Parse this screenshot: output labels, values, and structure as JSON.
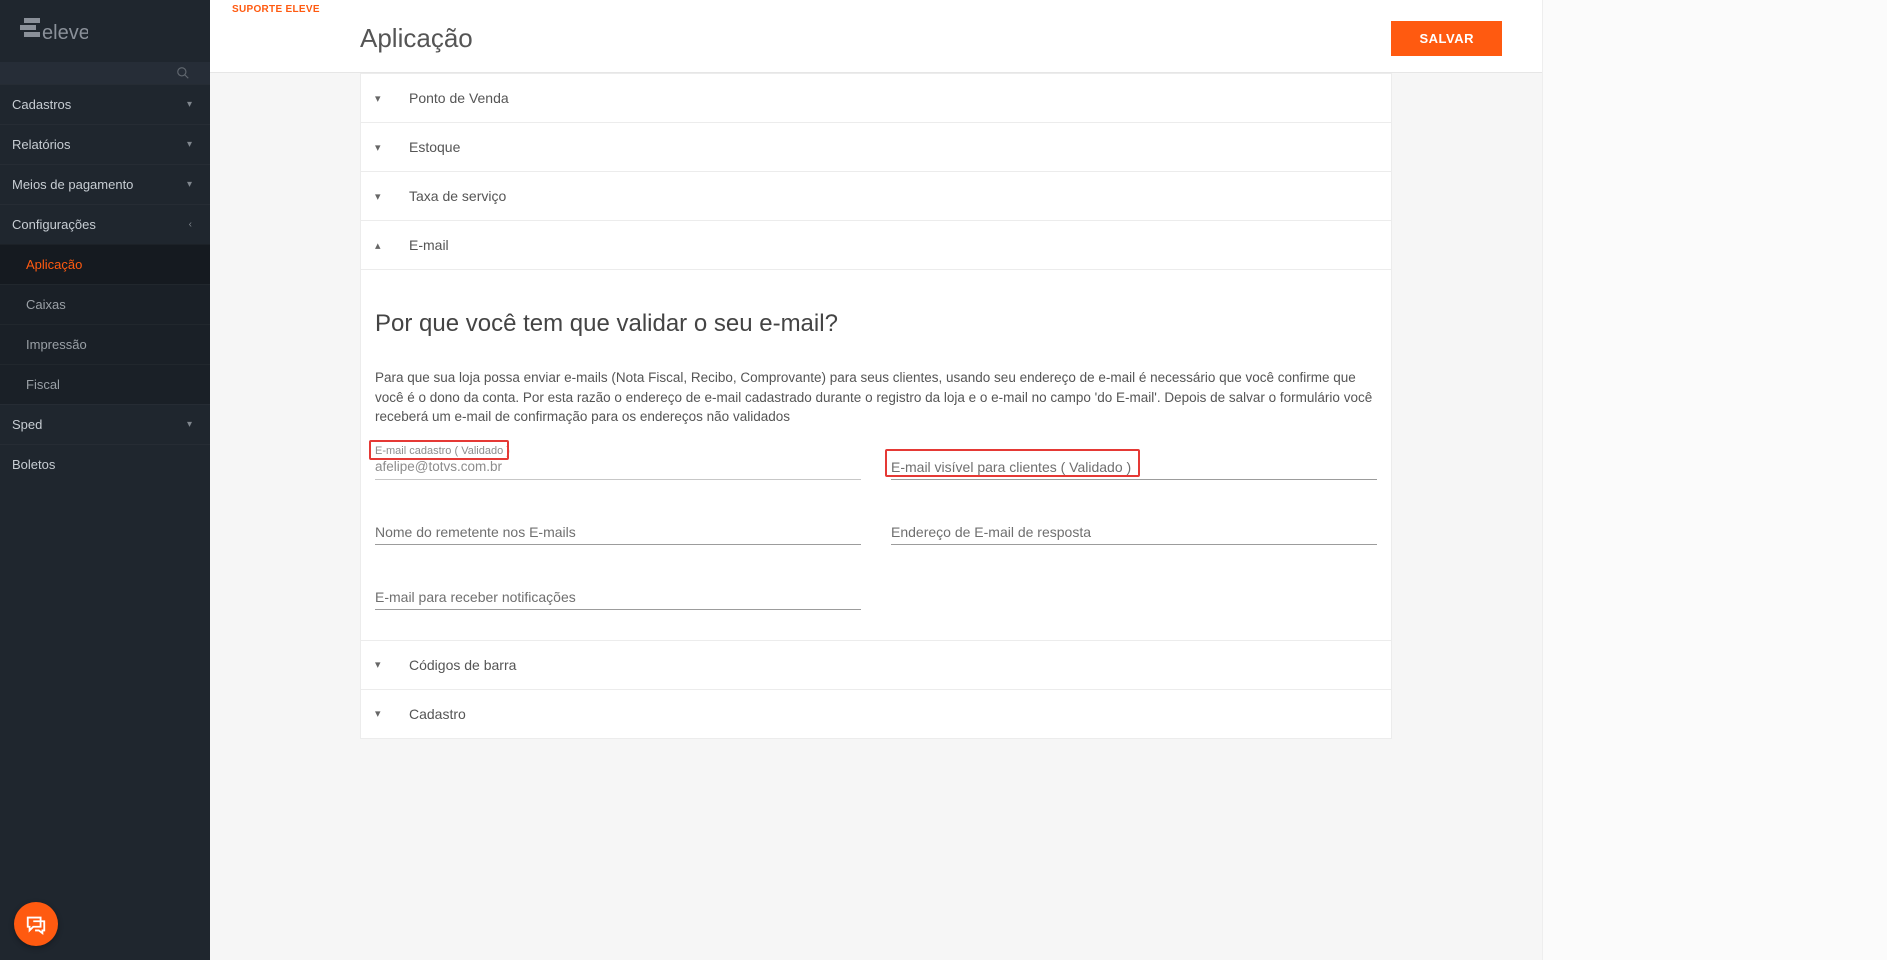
{
  "logo_text": "eleve",
  "breadcrumb": "SUPORTE ELEVE",
  "page_title": "Aplicação",
  "save_label": "SALVAR",
  "sidebar": {
    "items": [
      {
        "label": "Cadastros",
        "expandable": true,
        "expanded": false
      },
      {
        "label": "Relatórios",
        "expandable": true,
        "expanded": false
      },
      {
        "label": "Meios de pagamento",
        "expandable": true,
        "expanded": false
      },
      {
        "label": "Configurações",
        "expandable": true,
        "expanded": true,
        "children": [
          {
            "label": "Aplicação",
            "active": true
          },
          {
            "label": "Caixas",
            "active": false
          },
          {
            "label": "Impressão",
            "active": false
          },
          {
            "label": "Fiscal",
            "active": false
          }
        ]
      },
      {
        "label": "Sped",
        "expandable": true,
        "expanded": false
      },
      {
        "label": "Boletos",
        "expandable": false,
        "expanded": false
      }
    ]
  },
  "accordion": {
    "ponto_de_venda": {
      "label": "Ponto de Venda",
      "open": false
    },
    "estoque": {
      "label": "Estoque",
      "open": false
    },
    "taxa_servico": {
      "label": "Taxa de serviço",
      "open": false
    },
    "email": {
      "label": "E-mail",
      "open": true
    },
    "codigos_barra": {
      "label": "Códigos de barra",
      "open": false
    },
    "cadastro": {
      "label": "Cadastro",
      "open": false
    }
  },
  "email_section": {
    "heading": "Por que você tem que validar o seu e-mail?",
    "paragraph": "Para que sua loja possa enviar e-mails (Nota Fiscal, Recibo, Comprovante) para seus clientes, usando seu endereço de e-mail é necessário que você confirme que você é o dono da conta. Por esta razão o endereço de e-mail cadastrado durante o registro da loja e o e-mail no campo 'do E-mail'. Depois de salvar o formulário você receberá um e-mail de confirmação para os endereços não validados",
    "fields": {
      "email_cadastro": {
        "label": "E-mail cadastro ( Validado )",
        "value": "afelipe@totvs.com.br"
      },
      "email_visivel": {
        "label": "E-mail visível para clientes ( Validado )",
        "value": ""
      },
      "nome_remetente": {
        "label": "Nome do remetente nos E-mails",
        "value": ""
      },
      "endereco_resposta": {
        "label": "Endereço de E-mail de resposta",
        "value": ""
      },
      "email_notificacoes": {
        "label": "E-mail para receber notificações",
        "value": ""
      }
    }
  }
}
